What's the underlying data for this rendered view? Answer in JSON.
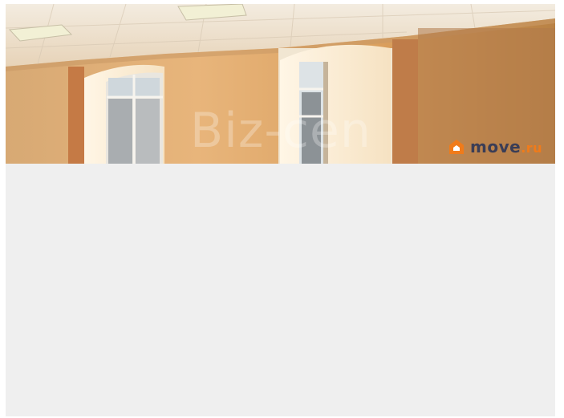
{
  "photo": {
    "watermark_text": "Biz-cen",
    "brand": {
      "name": "move",
      "suffix": ".ru",
      "icon": "house-icon",
      "colors": {
        "icon": "#f07b1a",
        "text": "#3a3d56"
      }
    }
  },
  "colors": {
    "viewer_background": "#efefef",
    "page_background": "#ffffff"
  }
}
